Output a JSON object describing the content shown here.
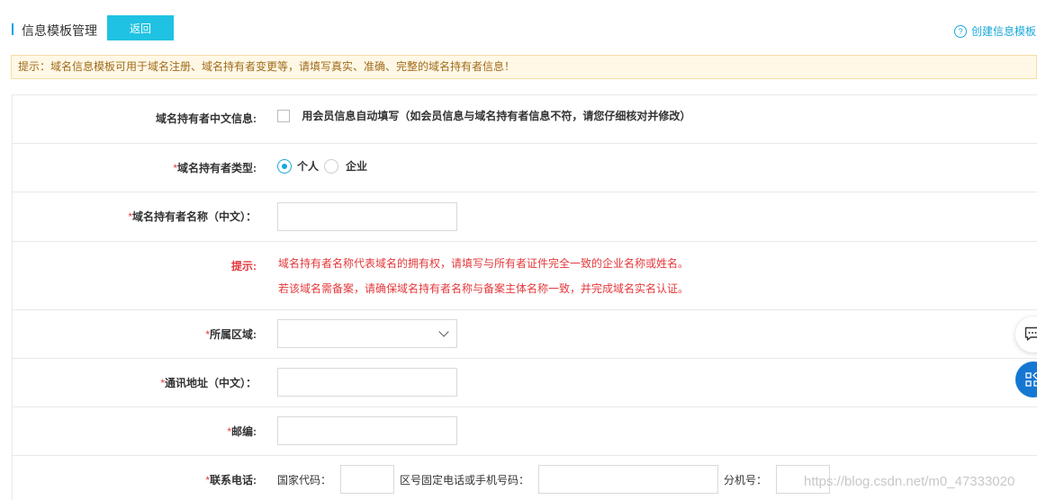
{
  "header": {
    "title": "信息模板管理",
    "back_label": "返回",
    "create_label": "创建信息模板",
    "help_glyph": "?"
  },
  "tip": {
    "text": "提示：域名信息模板可用于域名注册、域名持有者变更等，请填写真实、准确、完整的域名持有者信息！"
  },
  "form": {
    "autofill": {
      "label": "域名持有者中文信息:",
      "checkbox_label": "用会员信息自动填写（如会员信息与域名持有者信息不符，请您仔细核对并修改）",
      "checked": false
    },
    "owner_type": {
      "required": "*",
      "label": "域名持有者类型:",
      "options": [
        "个人",
        "企业"
      ],
      "selected": "个人"
    },
    "owner_name": {
      "required": "*",
      "label": "域名持有者名称（中文）：",
      "value": ""
    },
    "hint": {
      "label": "提示:",
      "line1": "域名持有者名称代表域名的拥有权，请填写与所有者证件完全一致的企业名称或姓名。",
      "line2": "若该域名需备案，请确保域名持有者名称与备案主体名称一致，并完成域名实名认证。"
    },
    "region": {
      "required": "*",
      "label": "所属区域:",
      "value": ""
    },
    "address": {
      "required": "*",
      "label": "通讯地址（中文）：",
      "value": ""
    },
    "postcode": {
      "required": "*",
      "label": "邮编:",
      "value": ""
    },
    "phone": {
      "required": "*",
      "label": "联系电话:",
      "country_code_label": "国家代码：",
      "number_label": "区号固定电话或手机号码：",
      "extension_label": "分机号："
    }
  },
  "widgets": {
    "chat_icon": "chat-bubble-icon",
    "apps_icon": "apps-grid-icon"
  },
  "watermark": "https://blog.csdn.net/m0_47333020",
  "colors": {
    "accent": "#1fc2e2",
    "link": "#1aa8d8",
    "required": "#e4393c",
    "tip_bg": "#fff8e6",
    "float_blue": "#1677d2"
  }
}
